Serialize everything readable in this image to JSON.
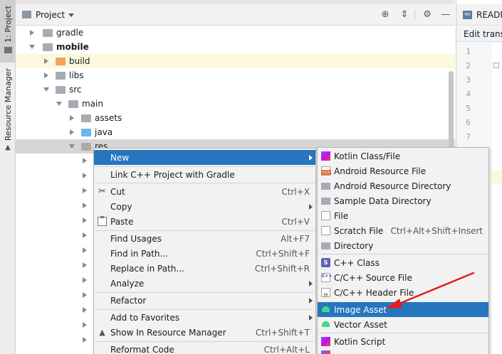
{
  "left_strip": {
    "project_tab": "1: Project",
    "resource_tab": "Resource Manager"
  },
  "panel": {
    "title": "Project"
  },
  "tree": [
    {
      "label": "gradle"
    },
    {
      "label": "mobile"
    },
    {
      "label": "build"
    },
    {
      "label": "libs"
    },
    {
      "label": "src"
    },
    {
      "label": "main"
    },
    {
      "label": "assets"
    },
    {
      "label": "java"
    },
    {
      "label": "res"
    }
  ],
  "editor": {
    "tab_label": "READM",
    "tab_icon_text": "MD",
    "banner_text": "Edit transla",
    "line_numbers": [
      "1",
      "2",
      "3",
      "4",
      "5",
      "6",
      "7"
    ]
  },
  "context_menu": [
    {
      "label": "New",
      "shortcut": ""
    },
    {
      "label": "Link C++ Project with Gradle",
      "shortcut": ""
    },
    {
      "label": "Cut",
      "shortcut": "Ctrl+X"
    },
    {
      "label": "Copy",
      "shortcut": ""
    },
    {
      "label": "Paste",
      "shortcut": "Ctrl+V"
    },
    {
      "label": "Find Usages",
      "shortcut": "Alt+F7"
    },
    {
      "label": "Find in Path...",
      "shortcut": "Ctrl+Shift+F"
    },
    {
      "label": "Replace in Path...",
      "shortcut": "Ctrl+Shift+R"
    },
    {
      "label": "Analyze",
      "shortcut": ""
    },
    {
      "label": "Refactor",
      "shortcut": ""
    },
    {
      "label": "Add to Favorites",
      "shortcut": ""
    },
    {
      "label": "Show In Resource Manager",
      "shortcut": "Ctrl+Shift+T"
    },
    {
      "label": "Reformat Code",
      "shortcut": "Ctrl+Alt+L"
    }
  ],
  "submenu": [
    {
      "label": "Kotlin Class/File",
      "shortcut": ""
    },
    {
      "label": "Android Resource File",
      "shortcut": ""
    },
    {
      "label": "Android Resource Directory",
      "shortcut": ""
    },
    {
      "label": "Sample Data Directory",
      "shortcut": ""
    },
    {
      "label": "File",
      "shortcut": ""
    },
    {
      "label": "Scratch File",
      "shortcut": "Ctrl+Alt+Shift+Insert"
    },
    {
      "label": "Directory",
      "shortcut": ""
    },
    {
      "label": "C++ Class",
      "shortcut": ""
    },
    {
      "label": "C/C++ Source File",
      "shortcut": ""
    },
    {
      "label": "C/C++ Header File",
      "shortcut": ""
    },
    {
      "label": "Image Asset",
      "shortcut": ""
    },
    {
      "label": "Vector Asset",
      "shortcut": ""
    },
    {
      "label": "Kotlin Script",
      "shortcut": ""
    }
  ],
  "icons": {
    "cpp_class": "S",
    "cpp_source": "C++",
    "cpp_header": "H"
  },
  "colors": {
    "selection": "#2675bf",
    "annotation_arrow": "#e02020",
    "android_green": "#3ddc84"
  }
}
